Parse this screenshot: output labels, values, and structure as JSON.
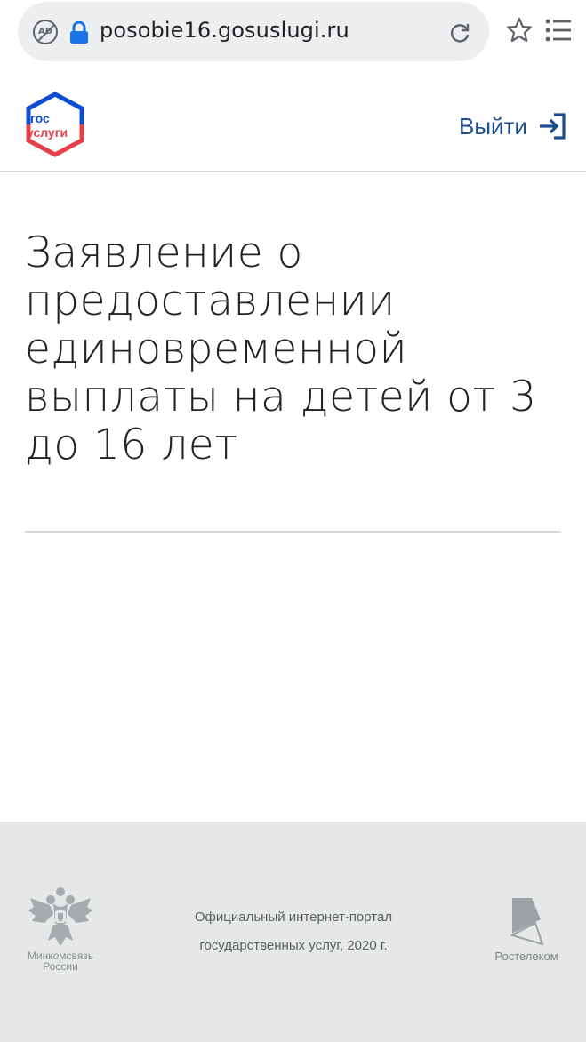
{
  "browser": {
    "url": "posobie16.gosuslugi.ru",
    "icons": [
      "adblock-icon",
      "lock-icon",
      "reload-icon",
      "star-icon",
      "menu-icon"
    ]
  },
  "header": {
    "logo_line1": "гос",
    "logo_line2": "услуги",
    "logout_label": "Выйти",
    "logout_icon": "logout-icon",
    "accent_color": "#1a4d8f"
  },
  "main": {
    "title": "Заявление о предоставлении единовременной выплаты на детей от 3 до 16 лет"
  },
  "footer": {
    "ministry": {
      "line1": "Минкомсвязь",
      "line2": "России"
    },
    "portal_line1": "Официальный интернет-портал",
    "portal_line2": "государственных услуг, 2020 г.",
    "operator": "Ростелеком",
    "background": "#e5e8e7"
  }
}
